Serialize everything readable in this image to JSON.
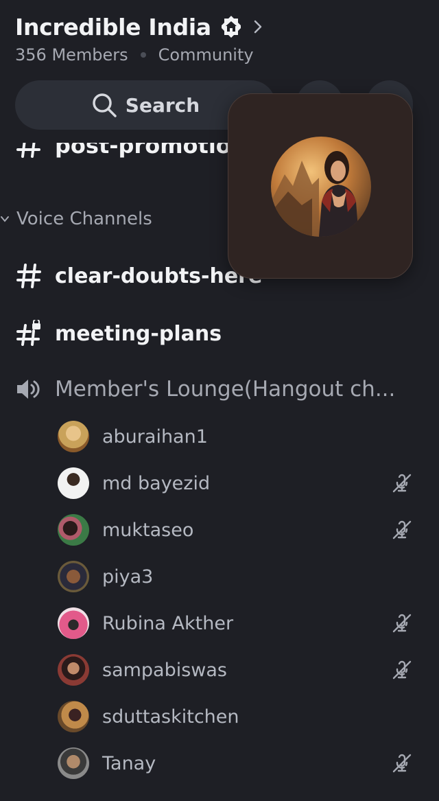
{
  "header": {
    "server_name": "Incredible India",
    "members": "356 Members",
    "community": "Community"
  },
  "search": {
    "label": "Search"
  },
  "channels": {
    "partial": "post-promotion",
    "voice_category": "Voice Channels",
    "text": [
      {
        "name": "clear-doubts-here",
        "icon": "hash-icon"
      },
      {
        "name": "meeting-plans",
        "icon": "locked-hash-icon"
      }
    ],
    "voice": {
      "name": "Member's Lounge(Hangout ch...",
      "icon": "speaker-icon"
    }
  },
  "members": [
    {
      "name": "aburaihan1",
      "muted": false,
      "avatar": "#c9a25a"
    },
    {
      "name": "md bayezid",
      "muted": true,
      "avatar": "#e6e6e6"
    },
    {
      "name": "muktaseo",
      "muted": true,
      "avatar": "#3b7a46"
    },
    {
      "name": "piya3",
      "muted": false,
      "avatar": "#5a4a3a"
    },
    {
      "name": "Rubina Akther",
      "muted": true,
      "avatar": "#e25a8a"
    },
    {
      "name": "sampabiswas",
      "muted": true,
      "avatar": "#8a3a34"
    },
    {
      "name": "sduttaskitchen",
      "muted": false,
      "avatar": "#b07a3a"
    },
    {
      "name": "Tanay",
      "muted": true,
      "avatar": "#6a6a6a"
    }
  ],
  "colors": {
    "background": "#1e1f25",
    "surface": "#2c2f37",
    "muted_text": "#a6a9b2"
  }
}
